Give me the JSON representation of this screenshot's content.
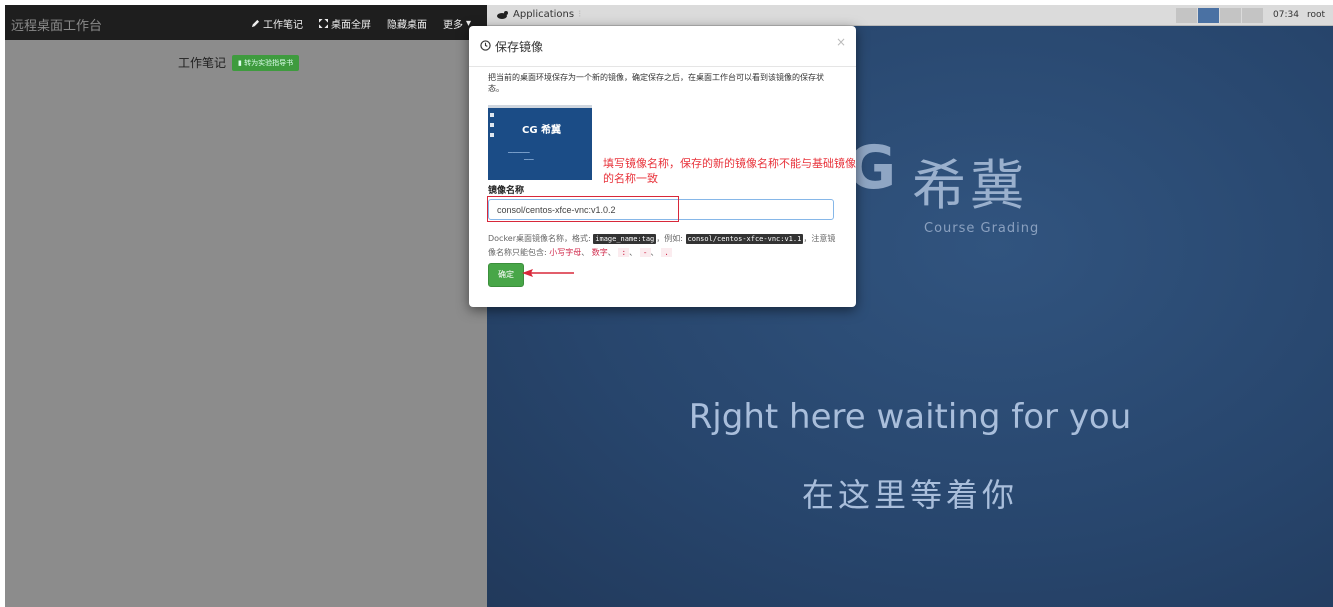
{
  "topbar": {
    "brand": "远程桌面工作台",
    "nav": [
      {
        "icon": "pencil-icon",
        "label": "工作笔记"
      },
      {
        "icon": "expand-icon",
        "label": "桌面全屏"
      },
      {
        "icon": "",
        "label": "隐藏桌面"
      },
      {
        "icon": "chevron-down-icon",
        "label": "更多"
      }
    ]
  },
  "notes": {
    "title": "工作笔记",
    "button_label": "转为实验指导书"
  },
  "desktop": {
    "applications_label": "Applications",
    "clock": "07:34",
    "user": "root",
    "logo_cn": "希冀",
    "logo_sub": "Course Grading",
    "tagline": "Rjght here waiting for you",
    "tagline_cn": "在这里等着你"
  },
  "modal": {
    "title": "保存镜像",
    "close": "×",
    "description": "把当前的桌面环境保存为一个新的镜像，确定保存之后，在桌面工作台可以看到该镜像的保存状态。",
    "thumb_logo": "CG 希冀",
    "annotation": "填写镜像名称，保存的新的镜像名称不能与基础镜像的名称一致",
    "field_label": "镜像名称",
    "field_value": "consol/centos-xfce-vnc:v1.0.2",
    "help_prefix": "Docker桌面镜像名称，格式:",
    "help_format": "image_name:tag",
    "help_example_label": "，例如:",
    "help_example": "consol/centos-xfce-vnc:v1.1",
    "help_note": "，注意镜像名称只能包含:",
    "help_allowed_1": "小写字母",
    "help_allowed_2": "数字",
    "help_allowed_3": ":",
    "help_allowed_4": "-",
    "help_allowed_5": ".",
    "ok_label": "确定"
  },
  "colors": {
    "accent_green": "#48a648",
    "annotation_red": "#e8343c",
    "desktop_blue": "#2b4a72"
  }
}
